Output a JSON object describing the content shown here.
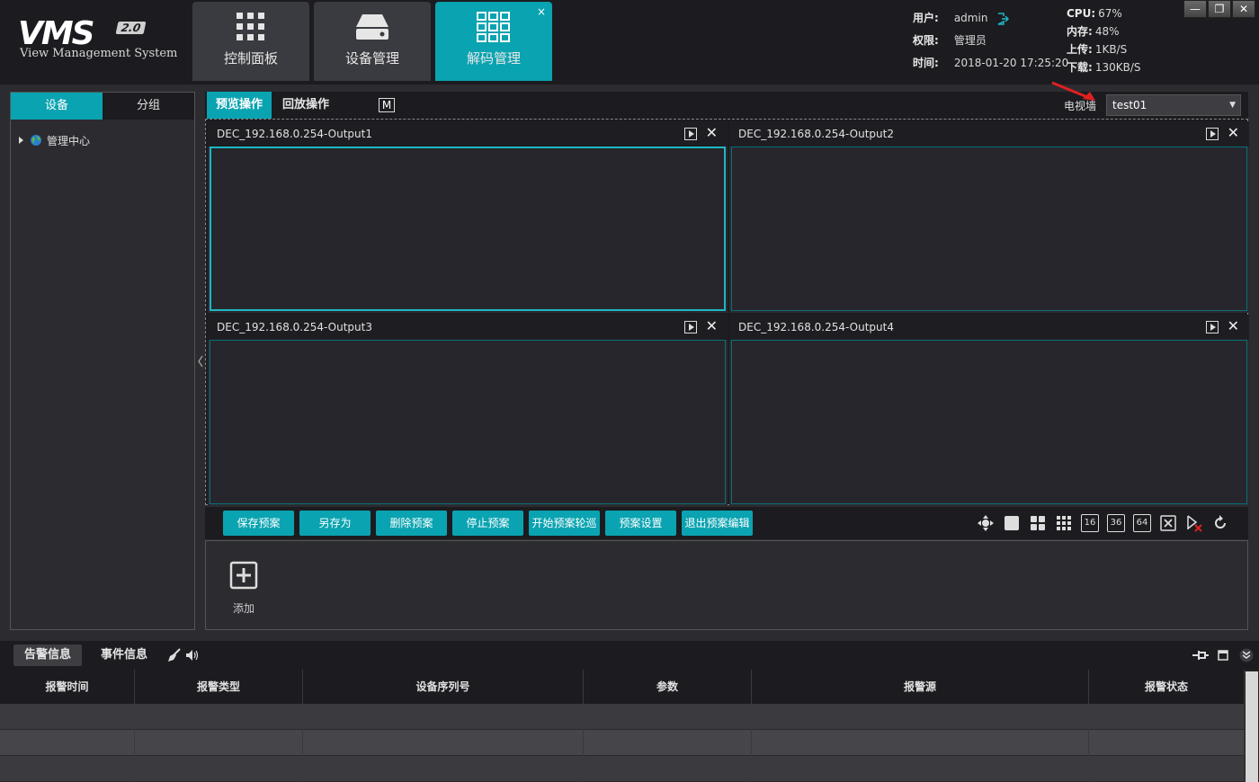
{
  "app": {
    "logo_main": "VMS",
    "logo_version": "2.0",
    "logo_subtitle": "View Management System"
  },
  "main_tabs": [
    {
      "label": "控制面板",
      "icon": "dots-grid-icon"
    },
    {
      "label": "设备管理",
      "icon": "device-drive-icon"
    },
    {
      "label": "解码管理",
      "icon": "squares-grid-icon",
      "close": "×"
    }
  ],
  "user": {
    "user_key": "用户:",
    "user_val": "admin",
    "role_key": "权限:",
    "role_val": "管理员",
    "time_key": "时间:",
    "time_val": "2018-01-20 17:25:20"
  },
  "sys": {
    "cpu_key": "CPU:",
    "cpu_val": "67%",
    "mem_key": "内存:",
    "mem_val": "48%",
    "up_key": "上传:",
    "up_val": "1KB/S",
    "down_key": "下载:",
    "down_val": "130KB/S"
  },
  "window_controls": {
    "minimize": "—",
    "restore": "❐",
    "close": "✕"
  },
  "left_panel": {
    "tabs": [
      "设备",
      "分组"
    ],
    "tree_root": "管理中心"
  },
  "center_tabs": {
    "preview": "预览操作",
    "playback": "回放操作",
    "m_label": "M",
    "tvwall_label": "电视墙",
    "tvwall_value": "test01"
  },
  "panes": [
    {
      "title": "DEC_192.168.0.254-Output1"
    },
    {
      "title": "DEC_192.168.0.254-Output2"
    },
    {
      "title": "DEC_192.168.0.254-Output3"
    },
    {
      "title": "DEC_192.168.0.254-Output4"
    }
  ],
  "actions": [
    "保存预案",
    "另存为",
    "删除预案",
    "停止预案",
    "开始预案轮巡",
    "预案设置",
    "退出预案编辑"
  ],
  "layout_icons": {
    "l16": "16",
    "l36": "36",
    "l64": "64"
  },
  "preset": {
    "add_label": "添加"
  },
  "bottom": {
    "tabs": [
      "告警信息",
      "事件信息"
    ],
    "columns": [
      "报警时间",
      "报警类型",
      "设备序列号",
      "参数",
      "报警源",
      "报警状态"
    ]
  },
  "colors": {
    "accent": "#0aa3b1",
    "background": "#2b2b30",
    "dark": "#1c1c20"
  }
}
